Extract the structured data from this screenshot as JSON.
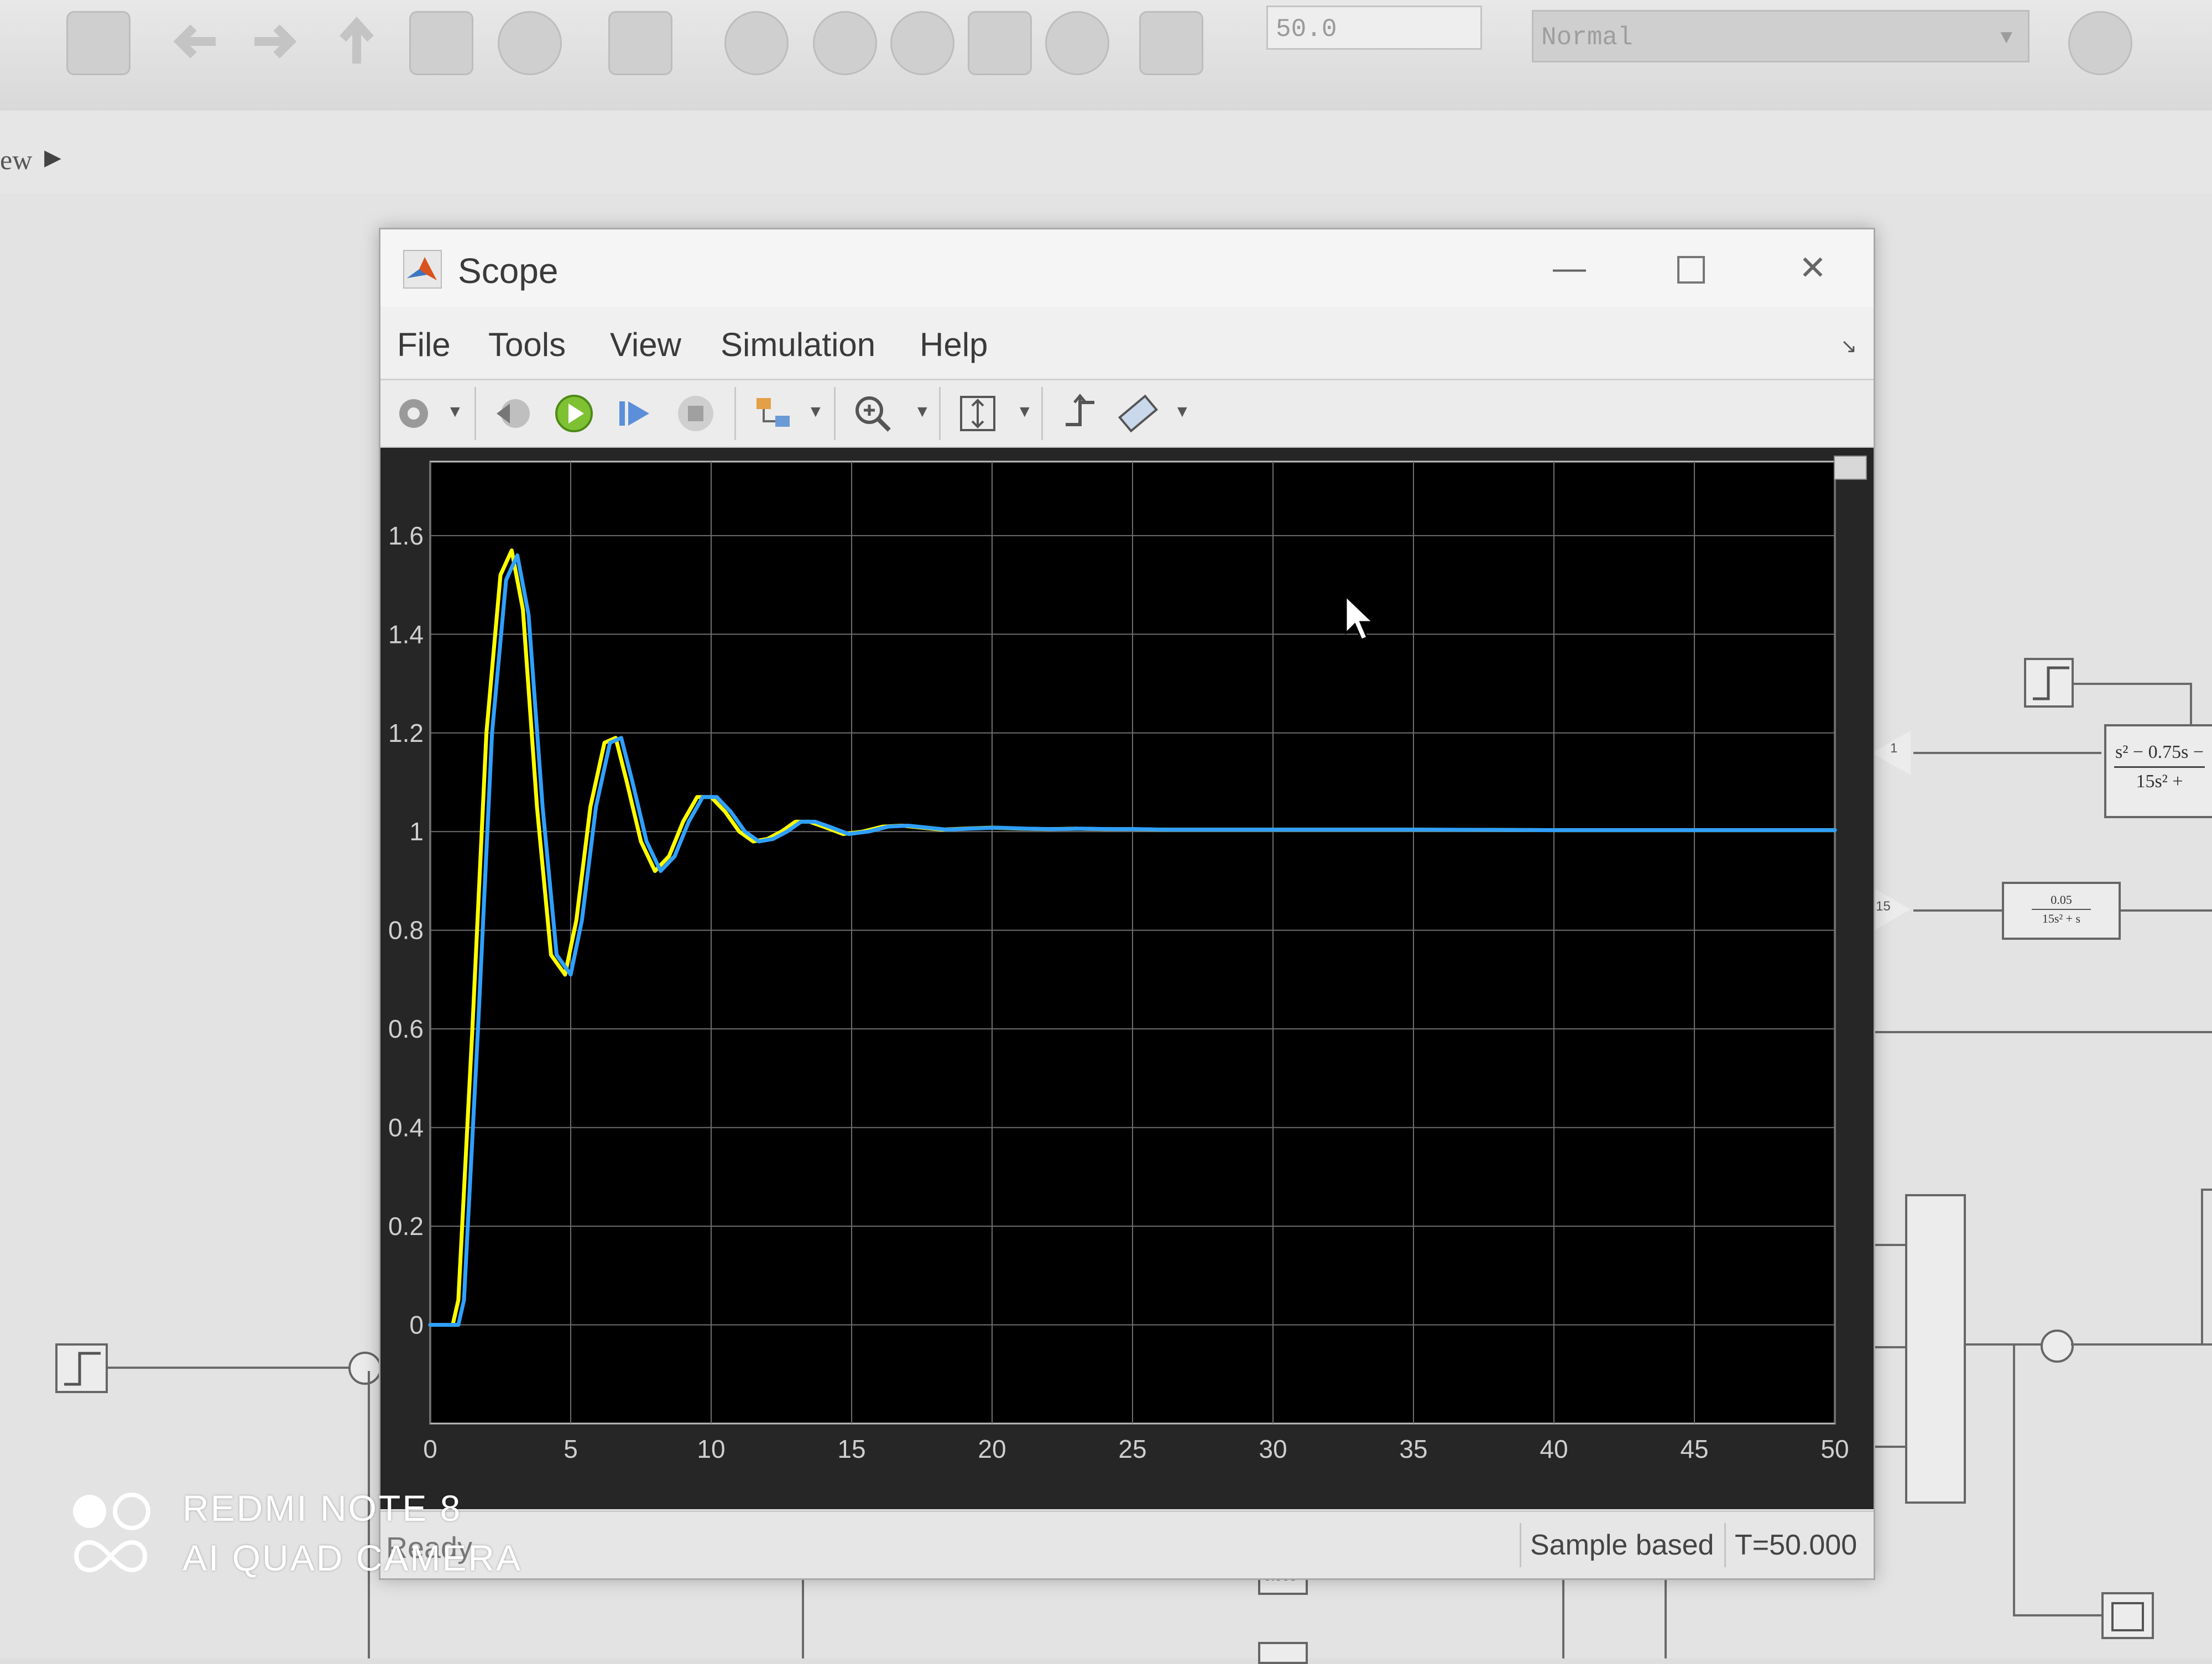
{
  "toolbar": {
    "stop_time": "50.0",
    "sim_mode": "Normal"
  },
  "breadcrumb": {
    "label": "ew"
  },
  "scope": {
    "title": "Scope",
    "menu": [
      {
        "label": "File"
      },
      {
        "label": "Tools"
      },
      {
        "label": "View"
      },
      {
        "label": "Simulation"
      },
      {
        "label": "Help"
      }
    ],
    "status": {
      "left": "Ready",
      "mode": "Sample based",
      "time": "T=50.000"
    }
  },
  "canvas": {
    "gain_labels": [
      "1",
      "15"
    ],
    "tf_top": "s² − 0.75s −",
    "tf_top_den": "15s² +",
    "tf_small_num": "0.05",
    "tf_small_den": "15s² + s",
    "block_label": "0.005"
  },
  "chart_data": {
    "type": "line",
    "title": "",
    "xlabel": "",
    "ylabel": "",
    "xlim": [
      0,
      50
    ],
    "ylim": [
      -0.2,
      1.75
    ],
    "xticks": [
      0,
      5,
      10,
      15,
      20,
      25,
      30,
      35,
      40,
      45,
      50
    ],
    "yticks": [
      0,
      0.2,
      0.4,
      0.6,
      0.8,
      1,
      1.2,
      1.4,
      1.6
    ],
    "ytick_labels": [
      "0",
      "0.2",
      "0.4",
      "0.6",
      "0.8",
      "1",
      "1.2",
      "1.4",
      "1.6"
    ],
    "grid": true,
    "series": [
      {
        "color": "#ffff00",
        "x": [
          0,
          0.8,
          1.0,
          1.5,
          2.0,
          2.5,
          2.9,
          3.3,
          3.8,
          4.3,
          4.8,
          5.2,
          5.7,
          6.2,
          6.6,
          7.0,
          7.5,
          8.0,
          8.5,
          9.0,
          9.5,
          10.0,
          10.5,
          11.0,
          11.5,
          12.0,
          12.5,
          13.0,
          13.5,
          14.0,
          14.7,
          15.4,
          16.1,
          16.8,
          17.5,
          18.2,
          19.0,
          20.0,
          21.0,
          22.0,
          23.0,
          24.0,
          25.0,
          26.0,
          28.0,
          30.0,
          35.0,
          40.0,
          45.0,
          50.0
        ],
        "y": [
          0,
          0,
          0.05,
          0.6,
          1.2,
          1.52,
          1.57,
          1.45,
          1.05,
          0.75,
          0.71,
          0.82,
          1.05,
          1.18,
          1.19,
          1.1,
          0.98,
          0.92,
          0.95,
          1.02,
          1.07,
          1.07,
          1.04,
          1.0,
          0.98,
          0.985,
          1.0,
          1.02,
          1.02,
          1.01,
          0.995,
          1.0,
          1.01,
          1.012,
          1.008,
          1.004,
          1.006,
          1.008,
          1.006,
          1.005,
          1.006,
          1.005,
          1.005,
          1.004,
          1.004,
          1.004,
          1.004,
          1.003,
          1.003,
          1.003
        ]
      },
      {
        "color": "#2fa0ff",
        "x": [
          0,
          1.0,
          1.2,
          1.7,
          2.2,
          2.7,
          3.1,
          3.5,
          4.0,
          4.5,
          5.0,
          5.4,
          5.9,
          6.4,
          6.8,
          7.2,
          7.7,
          8.2,
          8.7,
          9.2,
          9.7,
          10.2,
          10.7,
          11.2,
          11.7,
          12.2,
          12.7,
          13.2,
          13.7,
          14.2,
          14.9,
          15.6,
          16.3,
          17.0,
          17.7,
          18.4,
          19.2,
          20.2,
          21.2,
          22.2,
          23.2,
          24.2,
          25.2,
          26.2,
          28.2,
          30.2,
          35.2,
          40.2,
          45.2,
          50.0
        ],
        "y": [
          0,
          0,
          0.05,
          0.6,
          1.2,
          1.51,
          1.56,
          1.44,
          1.05,
          0.75,
          0.71,
          0.82,
          1.05,
          1.18,
          1.19,
          1.1,
          0.98,
          0.92,
          0.95,
          1.02,
          1.07,
          1.07,
          1.04,
          1.0,
          0.98,
          0.985,
          1.0,
          1.02,
          1.02,
          1.01,
          0.995,
          1.0,
          1.01,
          1.012,
          1.008,
          1.004,
          1.006,
          1.008,
          1.006,
          1.005,
          1.006,
          1.005,
          1.005,
          1.004,
          1.004,
          1.004,
          1.004,
          1.003,
          1.003,
          1.003
        ]
      }
    ]
  },
  "watermark": {
    "line1": "REDMI NOTE 8",
    "line2": "AI QUAD CAMERA"
  }
}
